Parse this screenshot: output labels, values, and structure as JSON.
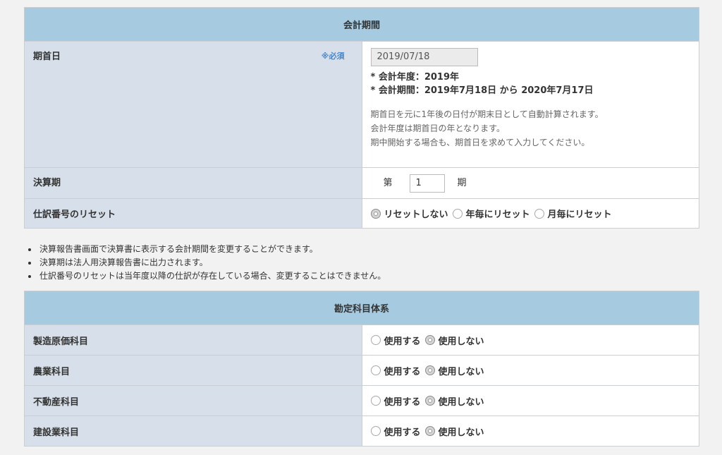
{
  "period": {
    "header": "会計期間",
    "start_date": {
      "label": "期首日",
      "required": "※必須",
      "value": "2019/07/18",
      "fiscal_year": "* 会計年度：2019年",
      "fiscal_period": "* 会計期間：2019年7月18日 から 2020年7月17日",
      "notes": [
        "期首日を元に1年後の日付が期末日として自動計算されます。",
        "会計年度は期首日の年となります。",
        "期中開始する場合も、期首日を求めて入力してください。"
      ]
    },
    "term": {
      "label": "決算期",
      "prefix": "第",
      "value": "1",
      "suffix": "期"
    },
    "reset": {
      "label": "仕訳番号のリセット",
      "options": [
        "リセットしない",
        "年毎にリセット",
        "月毎にリセット"
      ],
      "selected": "リセットしない"
    }
  },
  "bullets": [
    "決算報告書画面で決算書に表示する会計期間を変更することができます。",
    "決算期は法人用決算報告書に出力されます。",
    "仕訳番号のリセットは当年度以降の仕訳が存在している場合、変更することはできません。"
  ],
  "accounts": {
    "header": "勘定科目体系",
    "option_use": "使用する",
    "option_not_use": "使用しない",
    "rows": [
      {
        "label": "製造原価科目",
        "selected": "使用しない"
      },
      {
        "label": "農業科目",
        "selected": "使用しない"
      },
      {
        "label": "不動産科目",
        "selected": "使用しない"
      },
      {
        "label": "建設業科目",
        "selected": "使用しない"
      }
    ]
  }
}
